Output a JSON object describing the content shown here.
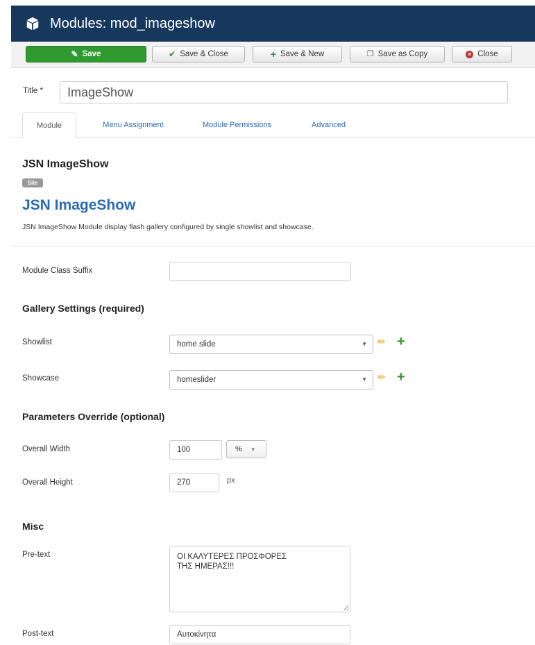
{
  "header": {
    "title": "Modules: mod_imageshow",
    "icon": "cube-icon"
  },
  "toolbar": {
    "save": "Save",
    "save_close": "Save & Close",
    "save_new": "Save & New",
    "save_copy": "Save as Copy",
    "close": "Close",
    "colors": {
      "save_bg": "#2f9a2f",
      "close_icon": "#bd362f",
      "header_bg": "#17385d"
    }
  },
  "title_field": {
    "label": "Title *",
    "value": "ImageShow"
  },
  "tabs": [
    "Module",
    "Menu Assignment",
    "Module Permissions",
    "Advanced"
  ],
  "module": {
    "name": "JSN ImageShow",
    "badge": "Site",
    "heading": "JSN ImageShow",
    "description": "JSN ImageShow Module display flash gallery configured by single showlist and showcase."
  },
  "fields": {
    "class_suffix": {
      "label": "Module Class Suffix",
      "value": ""
    },
    "gallery_section": "Gallery Settings (required)",
    "showlist": {
      "label": "Showlist",
      "value": "home slide"
    },
    "showcase": {
      "label": "Showcase",
      "value": "homeslider"
    },
    "params_section": "Parameters Override (optional)",
    "overall_width": {
      "label": "Overall Width",
      "value": "100",
      "unit": "%"
    },
    "overall_height": {
      "label": "Overall Height",
      "value": "270",
      "unit": "px"
    },
    "misc_section": "Misc",
    "pre_text": {
      "label": "Pre-text",
      "line1": "ΟΙ ΚΑΛΥΤΕΡΕΣ ΠΡΟΣΦΟΡΕΣ",
      "line2": "ΤΗΣ ΗΜΕΡΑΣ!!!"
    },
    "post_text": {
      "label": "Post-text",
      "value": "Αυτοκίνητα"
    }
  }
}
